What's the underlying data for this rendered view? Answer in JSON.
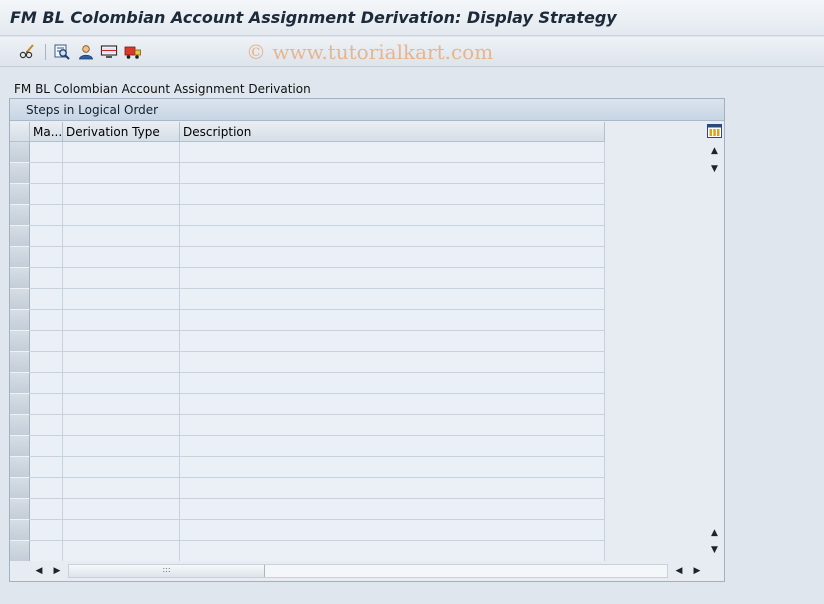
{
  "window": {
    "title": "FM BL Colombian Account Assignment Derivation: Display Strategy"
  },
  "toolbar": {
    "buttons": [
      {
        "name": "display-change-toggle",
        "icon": "pencil-glasses-icon"
      },
      {
        "name": "overview",
        "icon": "magnifier-icon"
      },
      {
        "name": "user",
        "icon": "person-icon"
      },
      {
        "name": "display-table",
        "icon": "monitor-icon"
      },
      {
        "name": "transport",
        "icon": "truck-icon"
      }
    ],
    "watermark": "© www.tutorialkart.com"
  },
  "section_label": "FM BL Colombian Account Assignment Derivation",
  "panel": {
    "title": "Steps in Logical Order",
    "columns": [
      "Ma...",
      "Derivation Type",
      "Description"
    ],
    "rows": [
      [
        "",
        "",
        ""
      ],
      [
        "",
        "",
        ""
      ],
      [
        "",
        "",
        ""
      ],
      [
        "",
        "",
        ""
      ],
      [
        "",
        "",
        ""
      ],
      [
        "",
        "",
        ""
      ],
      [
        "",
        "",
        ""
      ],
      [
        "",
        "",
        ""
      ],
      [
        "",
        "",
        ""
      ],
      [
        "",
        "",
        ""
      ],
      [
        "",
        "",
        ""
      ],
      [
        "",
        "",
        ""
      ],
      [
        "",
        "",
        ""
      ],
      [
        "",
        "",
        ""
      ],
      [
        "",
        "",
        ""
      ],
      [
        "",
        "",
        ""
      ],
      [
        "",
        "",
        ""
      ],
      [
        "",
        "",
        ""
      ],
      [
        "",
        "",
        ""
      ],
      [
        "",
        "",
        ""
      ]
    ]
  },
  "colors": {
    "background": "#dfe6ed",
    "cell": "#eaf0f5",
    "header": "#d6dee6",
    "watermark": "#e8a876"
  }
}
